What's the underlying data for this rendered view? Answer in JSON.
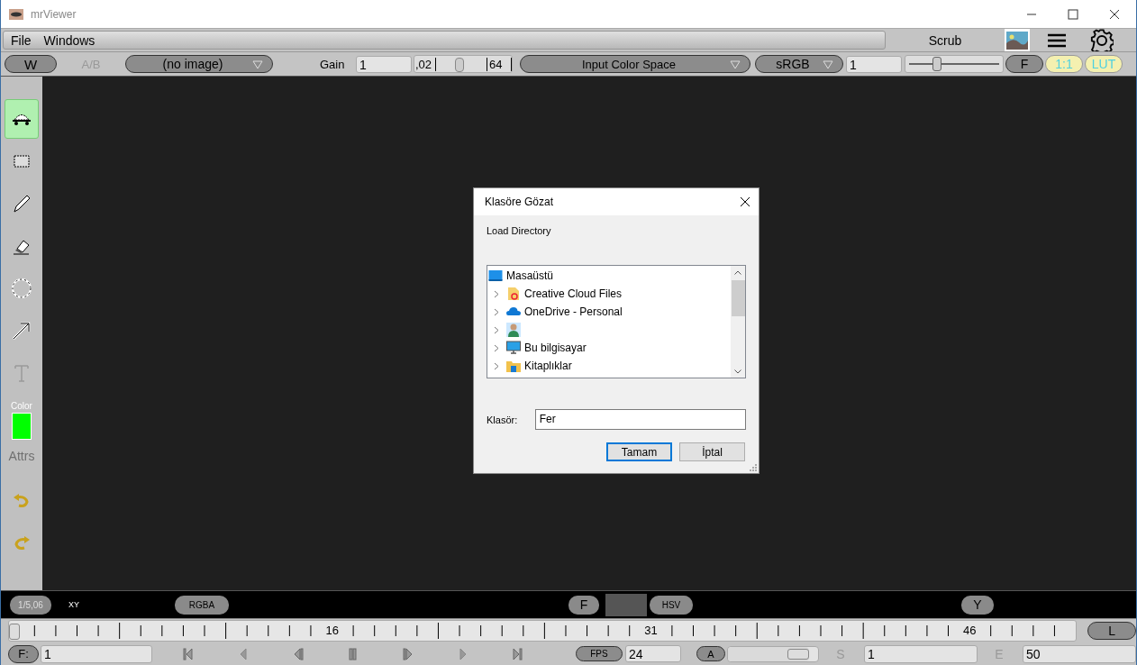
{
  "window": {
    "title": "mrViewer"
  },
  "menu": {
    "items": [
      "File",
      "Windows"
    ],
    "mode": "Scrub"
  },
  "toolbar": {
    "wipe": "W",
    "ab": {
      "label": "A/B",
      "disabled": true
    },
    "image": "(no image)",
    "gain": {
      "label": "Gain",
      "value": "1",
      "min": ",02",
      "level": 0.45,
      "max": "64"
    },
    "input_color_space": "Input Color Space",
    "display": "sRGB",
    "gamma": {
      "value": "1",
      "level": 0.3
    },
    "fstop": "F",
    "ratio": "1:1",
    "lut": "LUT"
  },
  "tools": [
    {
      "kind": "scrub",
      "selected": true
    },
    {
      "kind": "rect",
      "selected": false
    },
    {
      "kind": "pencil",
      "selected": false
    },
    {
      "kind": "eraser",
      "selected": false
    },
    {
      "kind": "circle",
      "selected": false
    },
    {
      "kind": "arrow",
      "selected": false
    },
    {
      "kind": "text",
      "selected": false,
      "disabled": true
    }
  ],
  "color": {
    "label": "Color",
    "color": "#00ff00"
  },
  "attrs": {
    "label": "Attrs",
    "disabled": true
  },
  "info_bar": {
    "zoom": "1/5,06",
    "coords": "XY",
    "channels": "RGBA",
    "f": "F",
    "hsv": "HSV",
    "y": "Y"
  },
  "timeline": {
    "level": 0,
    "labels": [
      "16",
      "31",
      "46"
    ],
    "loop": "L"
  },
  "playback": {
    "frame_label": "F:",
    "frame": "1",
    "fps_label": "FPS",
    "fps": "24",
    "audio": "A",
    "level": 0.9,
    "start_label": "S",
    "start": "1",
    "end_label": "E",
    "end": "50"
  },
  "dialog": {
    "title": "Klasöre Gözat",
    "prompt": "Load Directory",
    "tree": [
      {
        "label": "Masaüstü",
        "kind": "desktop",
        "children": [
          {
            "label": "Creative Cloud Files",
            "kind": "cloudfolder",
            "expanded": false
          },
          {
            "label": "OneDrive - Personal",
            "kind": "cloud",
            "expanded": false
          },
          {
            "kind": "user",
            "expanded": false
          },
          {
            "label": "Bu bilgisayar",
            "kind": "computer",
            "expanded": false
          },
          {
            "label": "Kitaplıklar",
            "kind": "library",
            "expanded": false
          }
        ]
      }
    ],
    "folder_label": "Klasör:",
    "folder_value": "Fer",
    "buttons": [
      {
        "label": "Tamam",
        "default": true
      },
      {
        "label": "İptal",
        "default": false
      }
    ]
  }
}
